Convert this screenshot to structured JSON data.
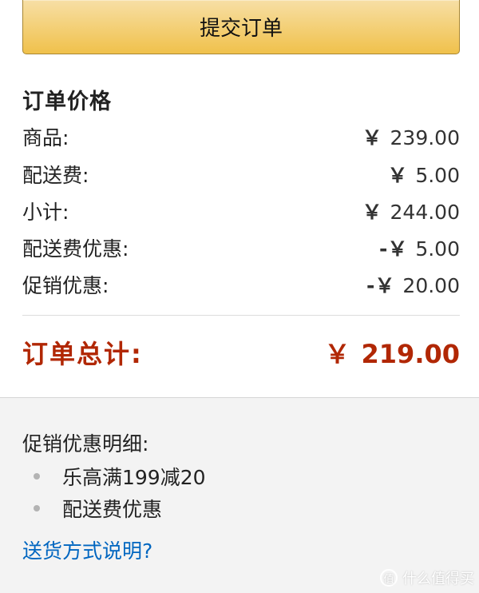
{
  "submit_button": {
    "label": "提交订单"
  },
  "summary": {
    "title": "订单价格",
    "rows": [
      {
        "label": "商品:",
        "currency": "￥",
        "value": "239.00"
      },
      {
        "label": "配送费:",
        "currency": "￥",
        "value": "5.00"
      },
      {
        "label": "小计:",
        "currency": "￥",
        "value": "244.00"
      },
      {
        "label": "配送费优惠:",
        "currency": "-￥",
        "value": "5.00"
      },
      {
        "label": "促销优惠:",
        "currency": "-￥",
        "value": "20.00"
      }
    ],
    "total": {
      "label": "订单总计:",
      "currency": "￥",
      "value": "219.00"
    }
  },
  "promotions": {
    "title": "促销优惠明细:",
    "items": [
      "乐高满199减20",
      "配送费优惠"
    ]
  },
  "shipping_link": {
    "label": "送货方式说明?"
  },
  "watermark": {
    "text": "值 什么值得买"
  },
  "colors": {
    "button_top": "#f7dfa5",
    "button_bottom": "#f0c14b",
    "total": "#b12704",
    "link": "#0066c0",
    "bottom_bg": "#f3f3f3"
  }
}
